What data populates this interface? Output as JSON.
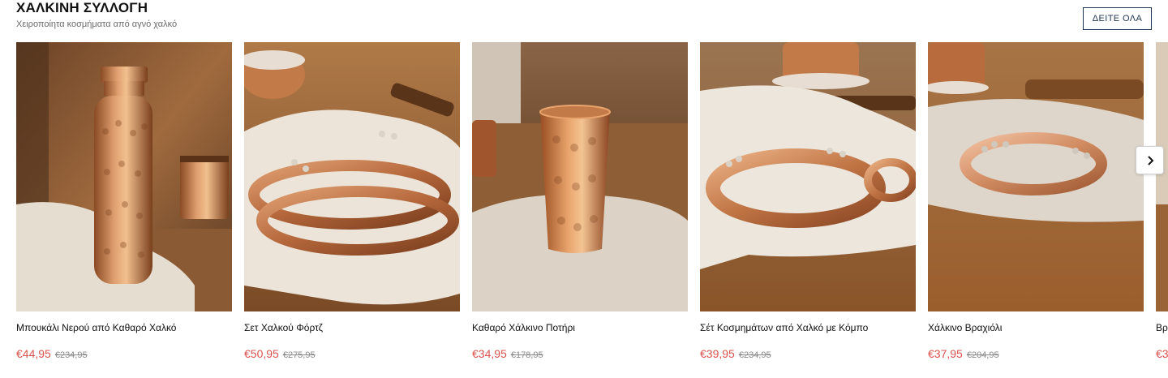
{
  "section": {
    "title": "ΧΑΛΚΙΝΗ ΣΥΛΛΟΓΗ",
    "subtitle": "Χειροποίητα κοσμήματα από αγνό χαλκό",
    "see_all_label": "ΔΕΙΤΕ ΟΛΑ"
  },
  "colors": {
    "sale_price": "#d9534f",
    "old_price": "#8a8a8a",
    "button_border": "#1e3452",
    "copper": "#c8753f"
  },
  "products": [
    {
      "name": "Μπουκάλι Νερού από Καθαρό Χαλκό",
      "price": "€44,95",
      "old_price": "€234,95",
      "image": "copper-bottle"
    },
    {
      "name": "Σετ Χαλκού Φόρτζ",
      "price": "€50,95",
      "old_price": "€275,95",
      "image": "copper-bracelet-set"
    },
    {
      "name": "Καθαρό Χάλκινο Ποτήρι",
      "price": "€34,95",
      "old_price": "€178,95",
      "image": "copper-cup"
    },
    {
      "name": "Σέτ Κοσμημάτων από Χαλκό με Κόμπο",
      "price": "€39,95",
      "old_price": "€234,95",
      "image": "copper-knot-set"
    },
    {
      "name": "Χάλκινο Βραχιόλι",
      "price": "€37,95",
      "old_price": "€204,95",
      "image": "copper-bracelet"
    },
    {
      "name": "Βρ",
      "price": "€3",
      "old_price": "",
      "image": "copper-partial"
    }
  ],
  "carousel": {
    "next_icon": "chevron-right-icon"
  }
}
